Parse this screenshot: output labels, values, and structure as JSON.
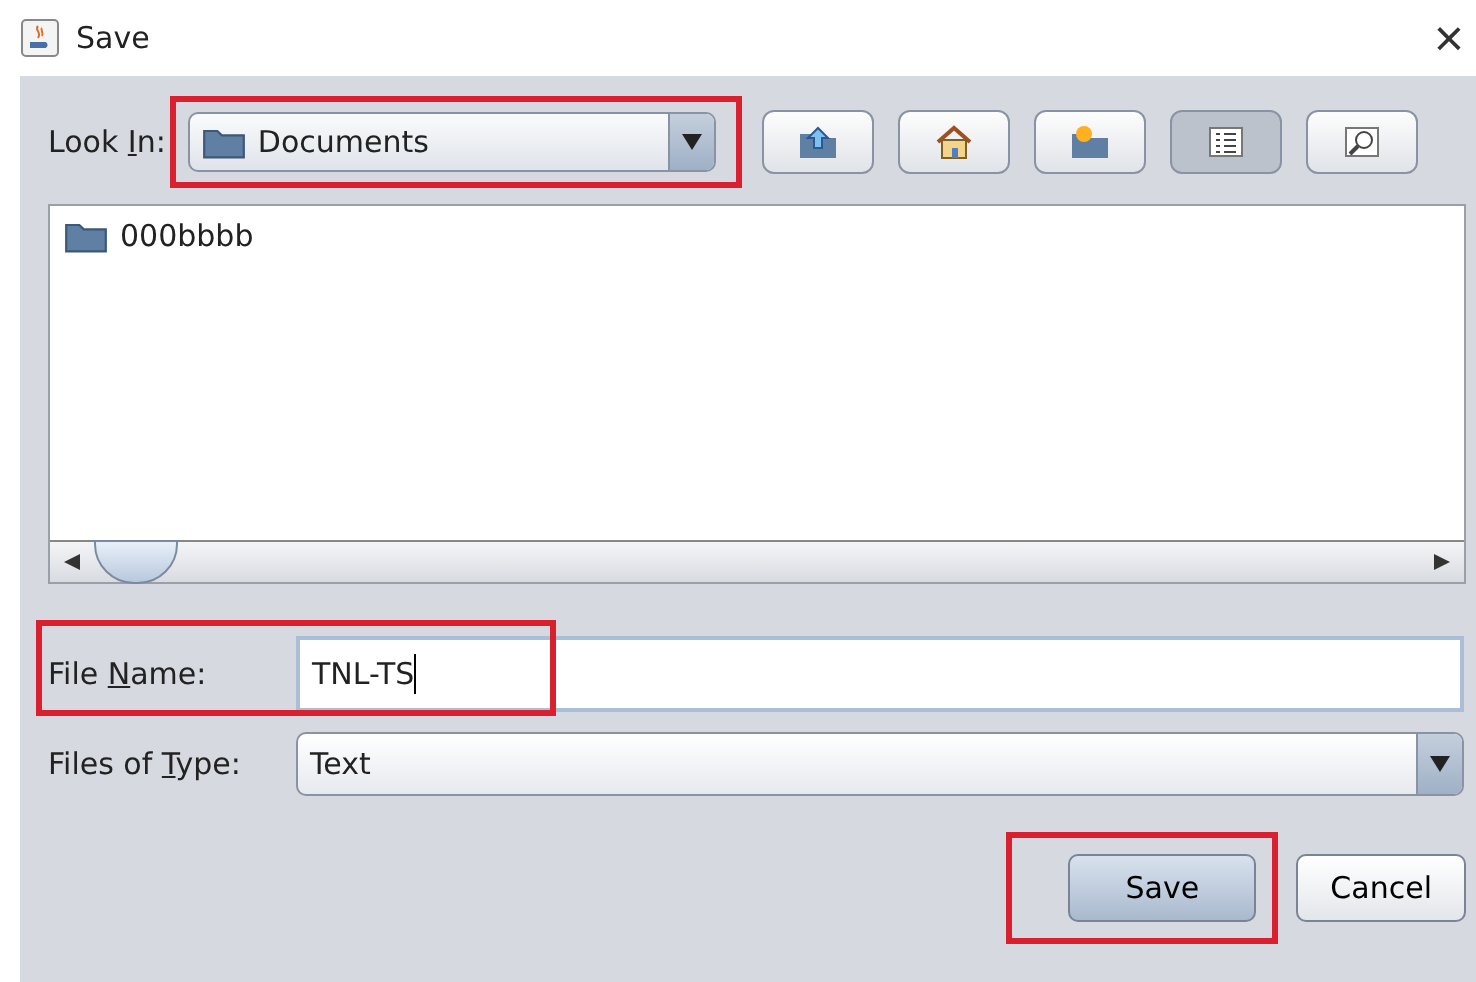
{
  "window": {
    "title": "Save",
    "close": "×"
  },
  "look_in": {
    "label": {
      "before": "Look ",
      "key": "I",
      "after": "n:"
    },
    "value": "Documents",
    "highlighted": true
  },
  "toolbar": [
    {
      "kind": "up",
      "selected": false
    },
    {
      "kind": "home",
      "selected": false
    },
    {
      "kind": "new-folder",
      "selected": false
    },
    {
      "kind": "list",
      "selected": true
    },
    {
      "kind": "details",
      "selected": false
    }
  ],
  "files": [
    {
      "name": "000bbbb"
    }
  ],
  "file_name": {
    "label": {
      "before": "File ",
      "key": "N",
      "after": "ame:"
    },
    "value": "TNL-TS",
    "highlighted": true
  },
  "file_type": {
    "label": {
      "before": "Files of ",
      "key": "T",
      "after": "ype:"
    },
    "value": "Text"
  },
  "buttons": [
    {
      "label": "Save",
      "highlighted": true,
      "default": true
    },
    {
      "label": "Cancel",
      "highlighted": false,
      "default": false
    }
  ]
}
